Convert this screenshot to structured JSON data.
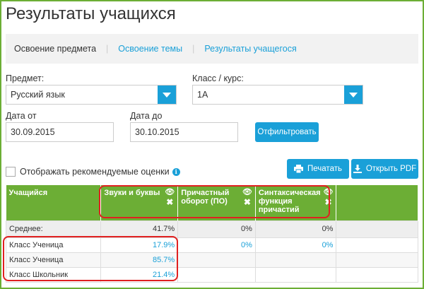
{
  "page": {
    "title": "Результаты учащихся"
  },
  "tabs": [
    {
      "label": "Освоение предмета",
      "active": true
    },
    {
      "label": "Освоение темы",
      "active": false
    },
    {
      "label": "Результаты учащегося",
      "active": false
    }
  ],
  "filters": {
    "subject": {
      "label": "Предмет:",
      "value": "Русский язык"
    },
    "class": {
      "label": "Класс / курс:",
      "value": "1А"
    },
    "date_from": {
      "label": "Дата от",
      "value": "30.09.2015"
    },
    "date_to": {
      "label": "Дата до",
      "value": "30.10.2015"
    },
    "filter_button": "Отфильтровать"
  },
  "options": {
    "recommended_label": "Отображать рекомендуемые оценки"
  },
  "actions": {
    "print_label": "Печатать",
    "pdf_label": "Открыть PDF"
  },
  "table": {
    "columns": {
      "student": "Учащийся",
      "topic1": "Звуки и буквы",
      "topic2": "Причастный оборот (ПО)",
      "topic3": "Синтаксическая функция причастий"
    },
    "average": {
      "label": "Среднее:",
      "values": [
        "41.7%",
        "0%",
        "0%"
      ]
    },
    "rows": [
      {
        "name": "Класс Ученица",
        "values": [
          "17.9%",
          "0%",
          "0%"
        ]
      },
      {
        "name": "Класс Ученица",
        "values": [
          "85.7%",
          "",
          ""
        ]
      },
      {
        "name": "Класс Школьник",
        "values": [
          "21.4%",
          "",
          ""
        ]
      }
    ]
  },
  "colors": {
    "accent": "#1aa0d8",
    "header": "#6cae35",
    "highlight": "#e02020"
  }
}
